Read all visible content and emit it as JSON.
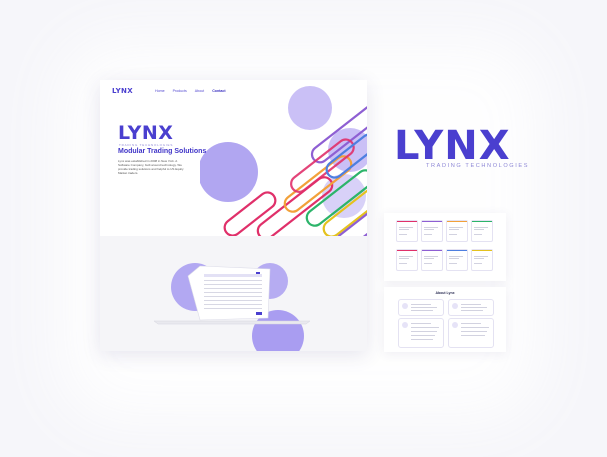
{
  "nav": {
    "logo": "LYNX",
    "items": [
      "Home",
      "Products",
      "About",
      "Contact"
    ],
    "active": "Contact"
  },
  "hero": {
    "logo": "LYNX",
    "tagline": "TRADING TECHNOLOGIES",
    "headline": "Modular Trading Solutions",
    "intro": "Lynx was established in 2008 in New York. A Software Company, built around technology. We provide trading solutions and helpful to US Equity Market traders."
  },
  "brand": {
    "logo": "LYNX",
    "subtitle": "TRADING TECHNOLOGIES"
  },
  "about": {
    "title": "About Lynx"
  },
  "colors": {
    "brand": "#4a3fcf",
    "accent_circle": "#a99cf0",
    "stripe_pink": "#e0306a",
    "stripe_purple": "#8e5fd3",
    "stripe_orange": "#f2a13a",
    "stripe_green": "#2cb46a",
    "stripe_yellow": "#e4c21e",
    "stripe_blue": "#4e7fe0"
  }
}
